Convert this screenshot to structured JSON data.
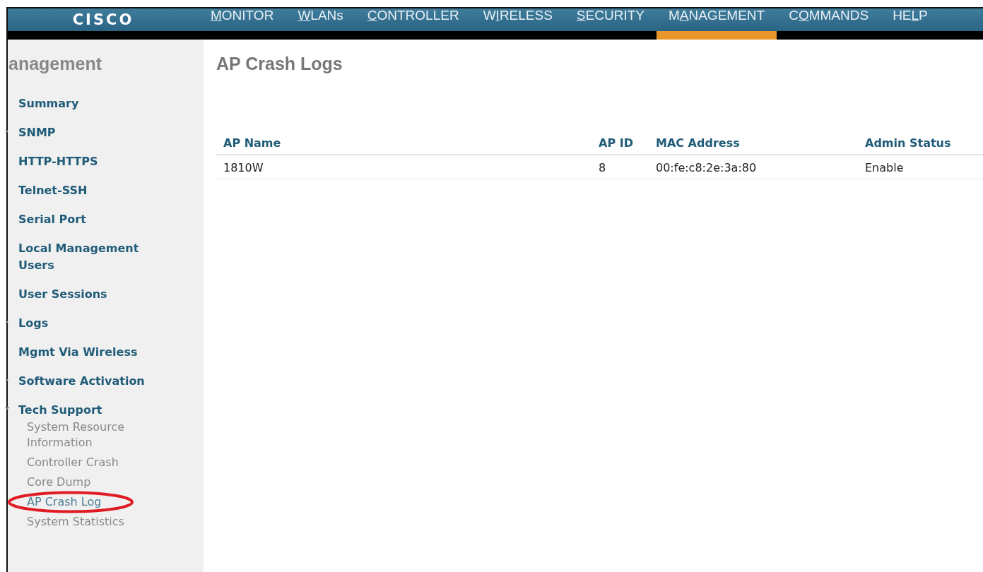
{
  "header": {
    "logo": "CISCO",
    "menu": [
      {
        "key": "M",
        "post": "ONITOR",
        "selected": false
      },
      {
        "key": "W",
        "post": "LANs",
        "selected": false
      },
      {
        "key": "C",
        "post": "ONTROLLER",
        "selected": false
      },
      {
        "pre": "W",
        "key": "I",
        "post": "RELESS",
        "selected": false
      },
      {
        "key": "S",
        "post": "ECURITY",
        "selected": false
      },
      {
        "pre": "M",
        "key": "A",
        "post": "NAGEMENT",
        "selected": true
      },
      {
        "pre": "C",
        "key": "O",
        "post": "MMANDS",
        "selected": false
      },
      {
        "pre": "HE",
        "key": "L",
        "post": "P",
        "selected": false
      }
    ]
  },
  "sidebar": {
    "title": "anagement",
    "items": [
      {
        "label": "Summary",
        "kind": "link"
      },
      {
        "label": "SNMP",
        "kind": "folder",
        "expanded": false
      },
      {
        "label": "HTTP-HTTPS",
        "kind": "link"
      },
      {
        "label": "Telnet-SSH",
        "kind": "link"
      },
      {
        "label": "Serial Port",
        "kind": "link"
      },
      {
        "label": "Local Management Users",
        "kind": "link"
      },
      {
        "label": "User Sessions",
        "kind": "link"
      },
      {
        "label": "Logs",
        "kind": "folder",
        "expanded": false
      },
      {
        "label": "Mgmt Via Wireless",
        "kind": "link"
      },
      {
        "label": "Software Activation",
        "kind": "folder",
        "expanded": false
      },
      {
        "label": "Tech Support",
        "kind": "folder",
        "expanded": true,
        "children": [
          {
            "label": "System Resource Information",
            "selected": false
          },
          {
            "label": "Controller Crash",
            "selected": false
          },
          {
            "label": "Core Dump",
            "selected": false
          },
          {
            "label": "AP Crash Log",
            "selected": true
          },
          {
            "label": "System Statistics",
            "selected": false
          }
        ]
      }
    ]
  },
  "page": {
    "title": "AP Crash Logs",
    "table": {
      "columns": [
        "AP Name",
        "AP ID",
        "MAC Address",
        "Admin Status"
      ],
      "rows": [
        [
          "1810W",
          "8",
          "00:fe:c8:2e:3a:80",
          "Enable"
        ]
      ]
    }
  }
}
